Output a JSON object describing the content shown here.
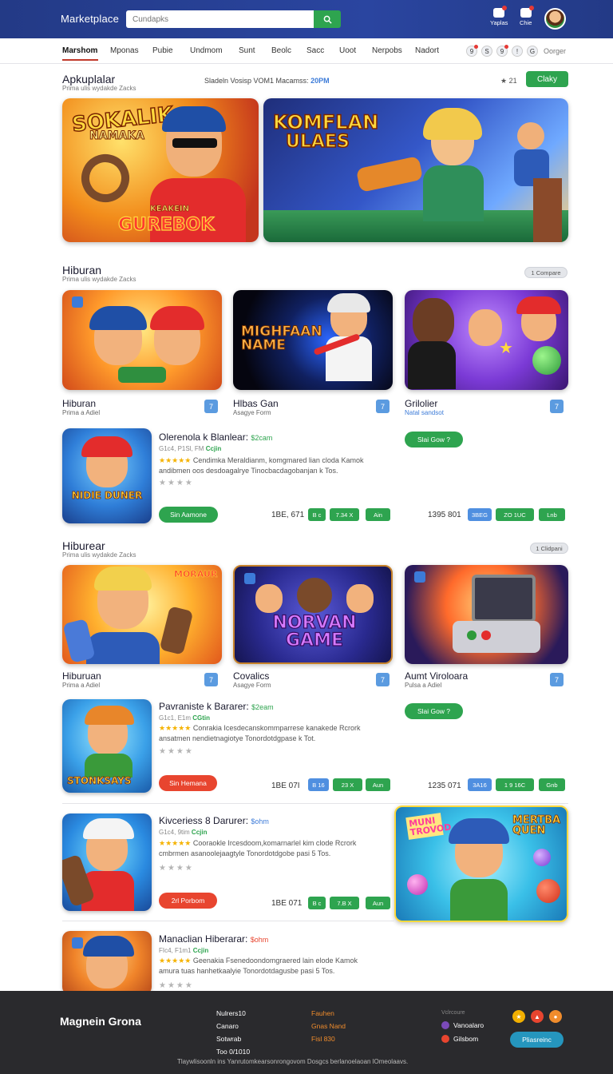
{
  "header": {
    "brand": "Marketplace",
    "search_placeholder": "Cundapks",
    "icons": [
      {
        "name": "notifications-icon",
        "label": "Yaplas"
      },
      {
        "name": "cart-icon",
        "label": "Chie"
      }
    ]
  },
  "nav": {
    "items": [
      "Marshom",
      "Mponas",
      "Pubie",
      "Undmom",
      "Sunt",
      "Beolc",
      "Sacc",
      "Uoot",
      "Nerpobs",
      "Nadort"
    ],
    "circles": [
      "9",
      "S",
      "9",
      "!",
      "G"
    ],
    "right_label": "Oorger"
  },
  "hero": {
    "title": "Apkuplalar",
    "subtitle": "Prima ulis wydakde Zacks",
    "search_meta": "Sladeln Vosisp VOM1 Macamss:",
    "search_meta_hl": "20PM",
    "rating": "★ 21",
    "button": "Claky",
    "banners": [
      {
        "name": "banner-sokalik",
        "text_top": "SOKALIK",
        "text_mid": "NAMAKA",
        "text_bottom": "GUREBOK",
        "text_bottom_small": "KEAKEIN"
      },
      {
        "name": "banner-komflan",
        "text_top": "KOMFLAN",
        "text_mid": "ULAES"
      }
    ]
  },
  "section1": {
    "title": "Hiburan",
    "subtitle": "Prima ulis wydakde Zacks",
    "pill": "1 Compare",
    "cards": [
      {
        "title": "Hiburan",
        "sub": "Prima a Adiel",
        "badge": "7",
        "art": "kids"
      },
      {
        "title": "Hlbas Gan",
        "sub": "Asagye Form",
        "badge": "7",
        "art_text": "MIGHFAAN NAME"
      },
      {
        "title": "Grilolier",
        "sub": "Natal sandsot",
        "badge": "7",
        "art": "party"
      }
    ],
    "apps": [
      {
        "title": "Olerenola k Blanlear:",
        "title_hl": "$2cam",
        "meta": "G1c4, P1Sl, FM",
        "meta_hl": "Ccjin",
        "desc_line1": "Cendimka Meraldianm, komgmared lian cloda Kamok",
        "desc_line2": "andibmen oos desdoagalrye Tinocbacdagobanjan k Tos.",
        "icon_text": "NIDIE DUNER",
        "button": "Sin Aamone",
        "price": "1BE, 671",
        "tags": [
          {
            "t": "B c",
            "c": "g",
            "w": 22
          },
          {
            "t": "7.34 X",
            "c": "g",
            "w": 37
          },
          {
            "t": "Ain",
            "c": "g",
            "w": 31
          }
        ],
        "side_button": "Slai Gow ?",
        "side_price": "1395 801",
        "side_tags": [
          {
            "t": "3BEG",
            "c": "b",
            "w": 30
          },
          {
            "t": "ZO 1UC",
            "c": "g",
            "w": 48
          },
          {
            "t": "Lnb",
            "c": "g",
            "w": 33
          }
        ]
      }
    ]
  },
  "section2": {
    "title": "Hiburear",
    "subtitle": "Prima ulis wydakde Zacks",
    "pill": "1 Clidpani",
    "cards": [
      {
        "title": "Hiburuan",
        "sub": "Prima a Adiel",
        "badge": "7",
        "art_text": "MORAUR"
      },
      {
        "title": "Covalics",
        "sub": "Asagye Form",
        "badge": "7",
        "art_text": "NORVAN GAME"
      },
      {
        "title": "Aumt Viroloara",
        "sub": "Pulsa a Adiel",
        "badge": "7",
        "art": "console"
      }
    ],
    "apps": [
      {
        "title": "Pavraniste k Bararer:",
        "title_hl": "$2eam",
        "meta": "G1c1, E1m",
        "meta_hl": "CGtin",
        "desc_line1": "Conrakia Icesdecanskommparrese kanakede Rcrork",
        "desc_line2": "ansatmen nendietnagiotye Tonordotdgpase k Tot.",
        "icon_text": "STONKSAYS",
        "button": "Sin Hemana",
        "button_color": "red",
        "price": "1BE 07I",
        "tags": [
          {
            "t": "B 16",
            "c": "b",
            "w": 26
          },
          {
            "t": "23 X",
            "c": "g",
            "w": 37
          },
          {
            "t": "Aun",
            "c": "g",
            "w": 31
          }
        ],
        "side_button": "Slai Gow ?",
        "side_price": "1235 071",
        "side_tags": [
          {
            "t": "3A16",
            "c": "b",
            "w": 30
          },
          {
            "t": "1 9 16C",
            "c": "g",
            "w": 48
          },
          {
            "t": "Gnb",
            "c": "g",
            "w": 33
          }
        ]
      },
      {
        "title": "Kivceriess 8 Darurer:",
        "title_hl": "$ohm",
        "title_hl_blue": true,
        "meta": "G1c4, 9tim",
        "meta_hl": "Ccjin",
        "desc_line1": "Cooraokle Ircesdoom,komarnarlel kim clode Rcrork",
        "desc_line2": "cmbrmen asanoolejaagtyle Tonordotdgobe pasi 5 Tos.",
        "button": "2rl Porbom",
        "button_color": "red",
        "price": "1BE 071",
        "tags": [
          {
            "t": "B c",
            "c": "g",
            "w": 22
          },
          {
            "t": "7.B X",
            "c": "g",
            "w": 37
          },
          {
            "t": "Aun",
            "c": "g",
            "w": 31
          }
        ],
        "promo_text": "MUNI TROVOD",
        "promo_text2": "MERTBA QUEN"
      },
      {
        "title": "Manaclian Hiberarar:",
        "title_hl": "$ohm",
        "meta": "FIc4, F1m1",
        "meta_hl": "Ccjin",
        "desc_line1": "Geenakia Fsenedoondomgraered lain elode Kamok",
        "desc_line2": "amura tuas hanhetkaalyie Tonordotdagusbe pasi 5 Tos."
      }
    ]
  },
  "footer": {
    "logo": "Magnein Grona",
    "col1": [
      "Nulrers10",
      "Canaro",
      "Sotwrab",
      "Too 0/1010"
    ],
    "col2": [
      "Fauhen",
      "Gnas Nand",
      "Fisl 830"
    ],
    "heading": "Vclrcoure",
    "links": [
      {
        "label": "Vanoalaro",
        "color": "#7b4ab8"
      },
      {
        "label": "Gilsbom",
        "color": "#e8452f"
      }
    ],
    "subscribe": "Pliasreinc",
    "copyright": "Tlaywlisoonln ins Yanrutomkearsonrongovom Dosgcs berlanoelaoan lOmeolaavs.",
    "social_colors": [
      "#f2b000",
      "#e8452f",
      "#f08c2c"
    ]
  },
  "colors": {
    "header_bg": "#2a45a0",
    "accent_green": "#2ea44f",
    "accent_red": "#e8452f",
    "accent_blue": "#4f8fe0",
    "footer_bg": "#2a2a2d"
  }
}
